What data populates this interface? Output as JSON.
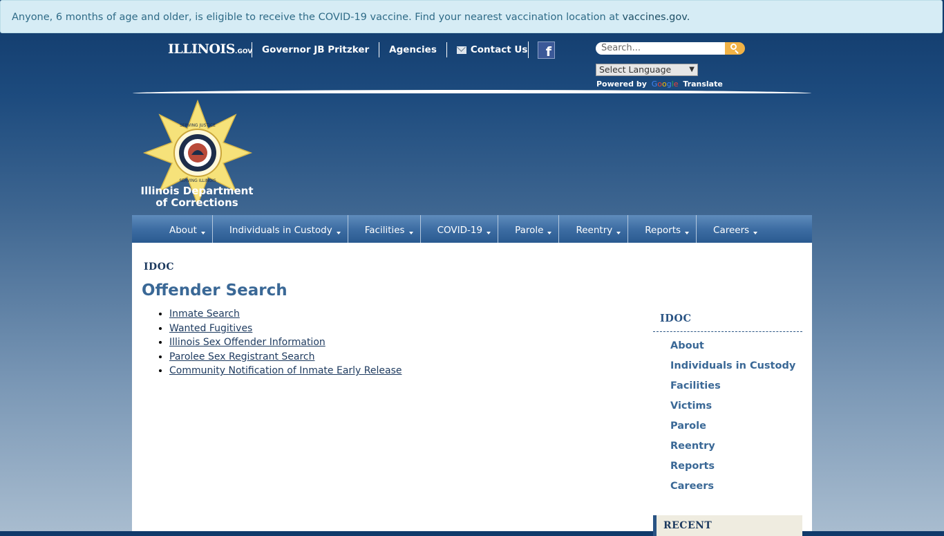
{
  "alert": {
    "text": "Anyone, 6 months of age and older, is eligible to receive the COVID-19 vaccine. Find your nearest vaccination location at",
    "link": "vaccines.gov."
  },
  "header": {
    "site_logo": "ILLINOIS",
    "site_logo_suffix": ".GOV",
    "top_links": [
      "Governor JB Pritzker",
      "Agencies",
      "Contact Us"
    ],
    "search_placeholder": "Search...",
    "language_select": "Select Language",
    "powered_by": "Powered by",
    "google": [
      "G",
      "o",
      "o",
      "g",
      "l",
      "e"
    ],
    "translate": "Translate"
  },
  "agency": {
    "name_line1": "Illinois Department",
    "name_line2": "of Corrections",
    "seal_text_top": "SERVING JUSTICE",
    "seal_text_bottom": "SERVING ILLINOIS"
  },
  "main_nav": [
    "About",
    "Individuals in Custody",
    "Facilities",
    "COVID-19",
    "Parole",
    "Reentry",
    "Reports",
    "Careers"
  ],
  "breadcrumb": "IDOC",
  "page_title": "Offender Search",
  "links": [
    "Inmate Search",
    "Wanted Fugitives",
    "Illinois Sex Offender Information",
    "Parolee Sex Registrant Search",
    "Community Notification of Inmate Early Release"
  ],
  "sidebar": {
    "title": "IDOC",
    "items": [
      "About",
      "Individuals in Custody",
      "Facilities",
      "Victims",
      "Parole",
      "Reentry",
      "Reports",
      "Careers"
    ],
    "recent_title": "RECENT"
  },
  "colors": {
    "accent": "#3a6896",
    "alert_bg": "#d6ecf5",
    "nav_bg": "#3d6da3",
    "search_button": "#f1b245"
  }
}
